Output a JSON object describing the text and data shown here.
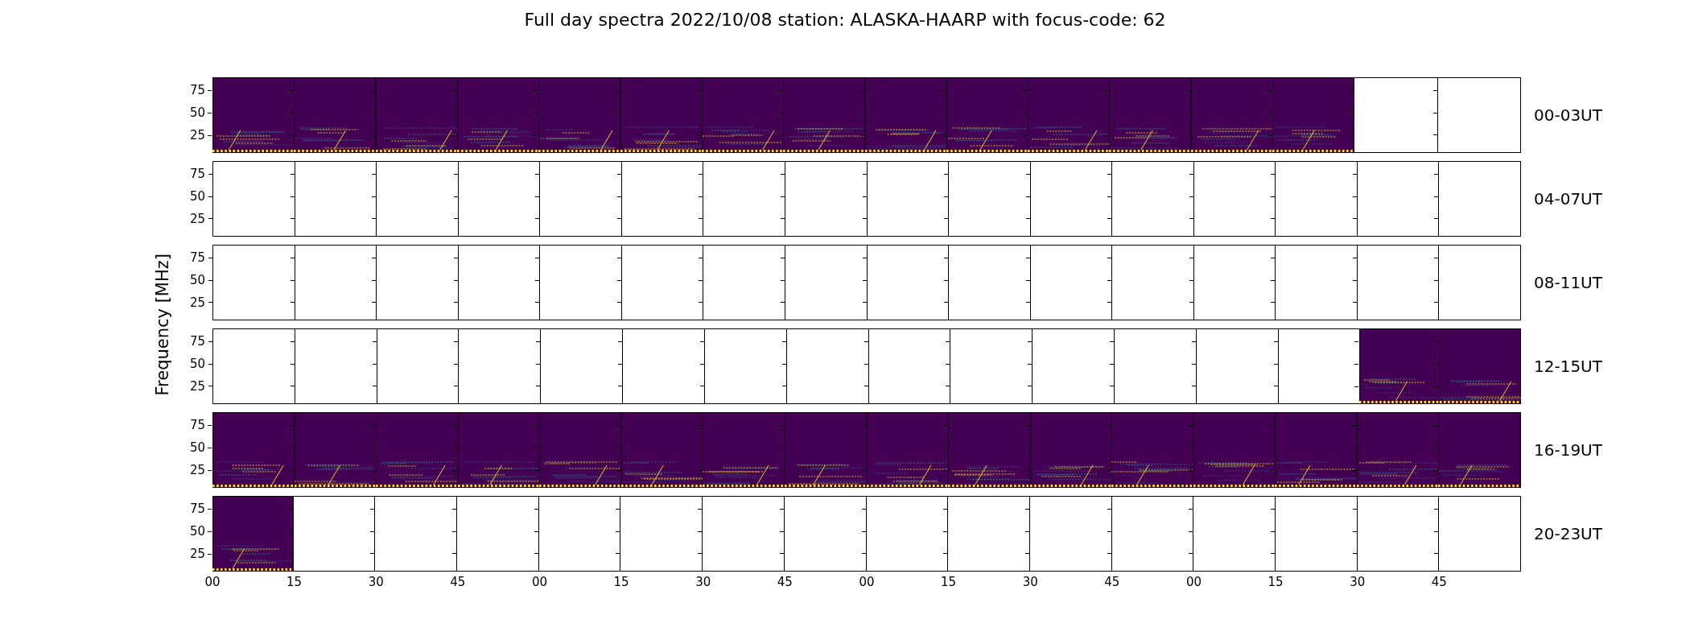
{
  "title": "Full day spectra 2022/10/08 station: ALASKA-HAARP with focus-code: 62",
  "ylabel": "Frequency [MHz]",
  "xticks": [
    "00",
    "15",
    "30",
    "45",
    "00",
    "15",
    "30",
    "45",
    "00",
    "15",
    "30",
    "45",
    "00",
    "15",
    "30",
    "45"
  ],
  "rows": [
    {
      "label": "00-03UT",
      "yticks": [
        "75",
        "50",
        "25"
      ],
      "panels": [
        {
          "filled": true
        },
        {
          "filled": true
        },
        {
          "filled": true
        },
        {
          "filled": true
        },
        {
          "filled": true
        },
        {
          "filled": true
        },
        {
          "filled": true
        },
        {
          "filled": true
        },
        {
          "filled": true
        },
        {
          "filled": true
        },
        {
          "filled": true
        },
        {
          "filled": true
        },
        {
          "filled": true
        },
        {
          "filled": true
        },
        {
          "filled": false
        },
        {
          "filled": false
        }
      ]
    },
    {
      "label": "04-07UT",
      "yticks": [
        "75",
        "50",
        "25"
      ],
      "panels": [
        {
          "filled": false
        },
        {
          "filled": false
        },
        {
          "filled": false
        },
        {
          "filled": false
        },
        {
          "filled": false
        },
        {
          "filled": false
        },
        {
          "filled": false
        },
        {
          "filled": false
        },
        {
          "filled": false
        },
        {
          "filled": false
        },
        {
          "filled": false
        },
        {
          "filled": false
        },
        {
          "filled": false
        },
        {
          "filled": false
        },
        {
          "filled": false
        },
        {
          "filled": false
        }
      ]
    },
    {
      "label": "08-11UT",
      "yticks": [
        "75",
        "50",
        "25"
      ],
      "panels": [
        {
          "filled": false
        },
        {
          "filled": false
        },
        {
          "filled": false
        },
        {
          "filled": false
        },
        {
          "filled": false
        },
        {
          "filled": false
        },
        {
          "filled": false
        },
        {
          "filled": false
        },
        {
          "filled": false
        },
        {
          "filled": false
        },
        {
          "filled": false
        },
        {
          "filled": false
        },
        {
          "filled": false
        },
        {
          "filled": false
        },
        {
          "filled": false
        },
        {
          "filled": false
        }
      ]
    },
    {
      "label": "12-15UT",
      "yticks": [
        "75",
        "50",
        "25"
      ],
      "panels": [
        {
          "filled": false
        },
        {
          "filled": false
        },
        {
          "filled": false
        },
        {
          "filled": false
        },
        {
          "filled": false
        },
        {
          "filled": false
        },
        {
          "filled": false
        },
        {
          "filled": false
        },
        {
          "filled": false
        },
        {
          "filled": false
        },
        {
          "filled": false
        },
        {
          "filled": false
        },
        {
          "filled": false
        },
        {
          "filled": false
        },
        {
          "filled": true
        },
        {
          "filled": true
        }
      ]
    },
    {
      "label": "16-19UT",
      "yticks": [
        "75",
        "50",
        "25"
      ],
      "panels": [
        {
          "filled": true
        },
        {
          "filled": true
        },
        {
          "filled": true
        },
        {
          "filled": true
        },
        {
          "filled": true
        },
        {
          "filled": true
        },
        {
          "filled": true
        },
        {
          "filled": true
        },
        {
          "filled": true
        },
        {
          "filled": true
        },
        {
          "filled": true
        },
        {
          "filled": true
        },
        {
          "filled": true
        },
        {
          "filled": true
        },
        {
          "filled": true
        },
        {
          "filled": true
        }
      ]
    },
    {
      "label": "20-23UT",
      "yticks": [
        "75",
        "50",
        "25"
      ],
      "panels": [
        {
          "filled": true
        },
        {
          "filled": false
        },
        {
          "filled": false
        },
        {
          "filled": false
        },
        {
          "filled": false
        },
        {
          "filled": false
        },
        {
          "filled": false
        },
        {
          "filled": false
        },
        {
          "filled": false
        },
        {
          "filled": false
        },
        {
          "filled": false
        },
        {
          "filled": false
        },
        {
          "filled": false
        },
        {
          "filled": false
        },
        {
          "filled": false
        },
        {
          "filled": false
        }
      ]
    }
  ]
}
